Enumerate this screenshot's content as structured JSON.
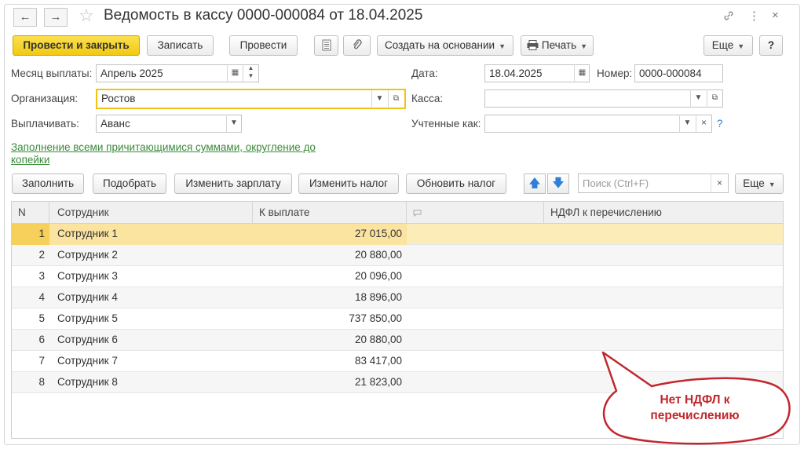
{
  "window": {
    "title": "Ведомость в кассу 0000-000084 от 18.04.2025",
    "back_icon": "←",
    "forward_icon": "→",
    "star_icon": "☆",
    "link_icon": "🔗",
    "more_icon": "⋮",
    "close_icon": "×"
  },
  "toolbar": {
    "post_close": "Провести и закрыть",
    "save": "Записать",
    "post": "Провести",
    "create_based": "Создать на основании",
    "print": "Печать",
    "more": "Еще",
    "help": "?"
  },
  "form": {
    "month_label": "Месяц выплаты:",
    "month_value": "Апрель 2025",
    "date_label": "Дата:",
    "date_value": "18.04.2025",
    "number_label": "Номер:",
    "number_value": "0000-000084",
    "org_label": "Организация:",
    "org_value": "Ростов",
    "cash_label": "Касса:",
    "cash_value": "",
    "pay_label": "Выплачивать:",
    "pay_value": "Аванс",
    "counted_label": "Учтенные как:",
    "counted_value": "",
    "help_mark": "?",
    "fill_link": "Заполнение всеми причитающимися суммами, округление до копейки"
  },
  "table_toolbar": {
    "fill": "Заполнить",
    "pick": "Подобрать",
    "change_salary": "Изменить зарплату",
    "change_tax": "Изменить налог",
    "update_tax": "Обновить налог",
    "search_placeholder": "Поиск (Ctrl+F)",
    "search_clear": "×",
    "more": "Еще"
  },
  "table": {
    "columns": [
      "N",
      "Сотрудник",
      "К выплате",
      "",
      "НДФЛ к перечислению"
    ],
    "rows": [
      {
        "n": "1",
        "employee": "Сотрудник 1",
        "amount": "27 015,00"
      },
      {
        "n": "2",
        "employee": "Сотрудник 2",
        "amount": "20 880,00"
      },
      {
        "n": "3",
        "employee": "Сотрудник 3",
        "amount": "20 096,00"
      },
      {
        "n": "4",
        "employee": "Сотрудник 4",
        "amount": "18 896,00"
      },
      {
        "n": "5",
        "employee": "Сотрудник 5",
        "amount": "737 850,00"
      },
      {
        "n": "6",
        "employee": "Сотрудник 6",
        "amount": "20 880,00"
      },
      {
        "n": "7",
        "employee": "Сотрудник 7",
        "amount": "83 417,00"
      },
      {
        "n": "8",
        "employee": "Сотрудник 8",
        "amount": "21 823,00"
      }
    ]
  },
  "callout": {
    "text_line1": "Нет НДФЛ к",
    "text_line2": "перечислению",
    "color": "#c1272d"
  }
}
